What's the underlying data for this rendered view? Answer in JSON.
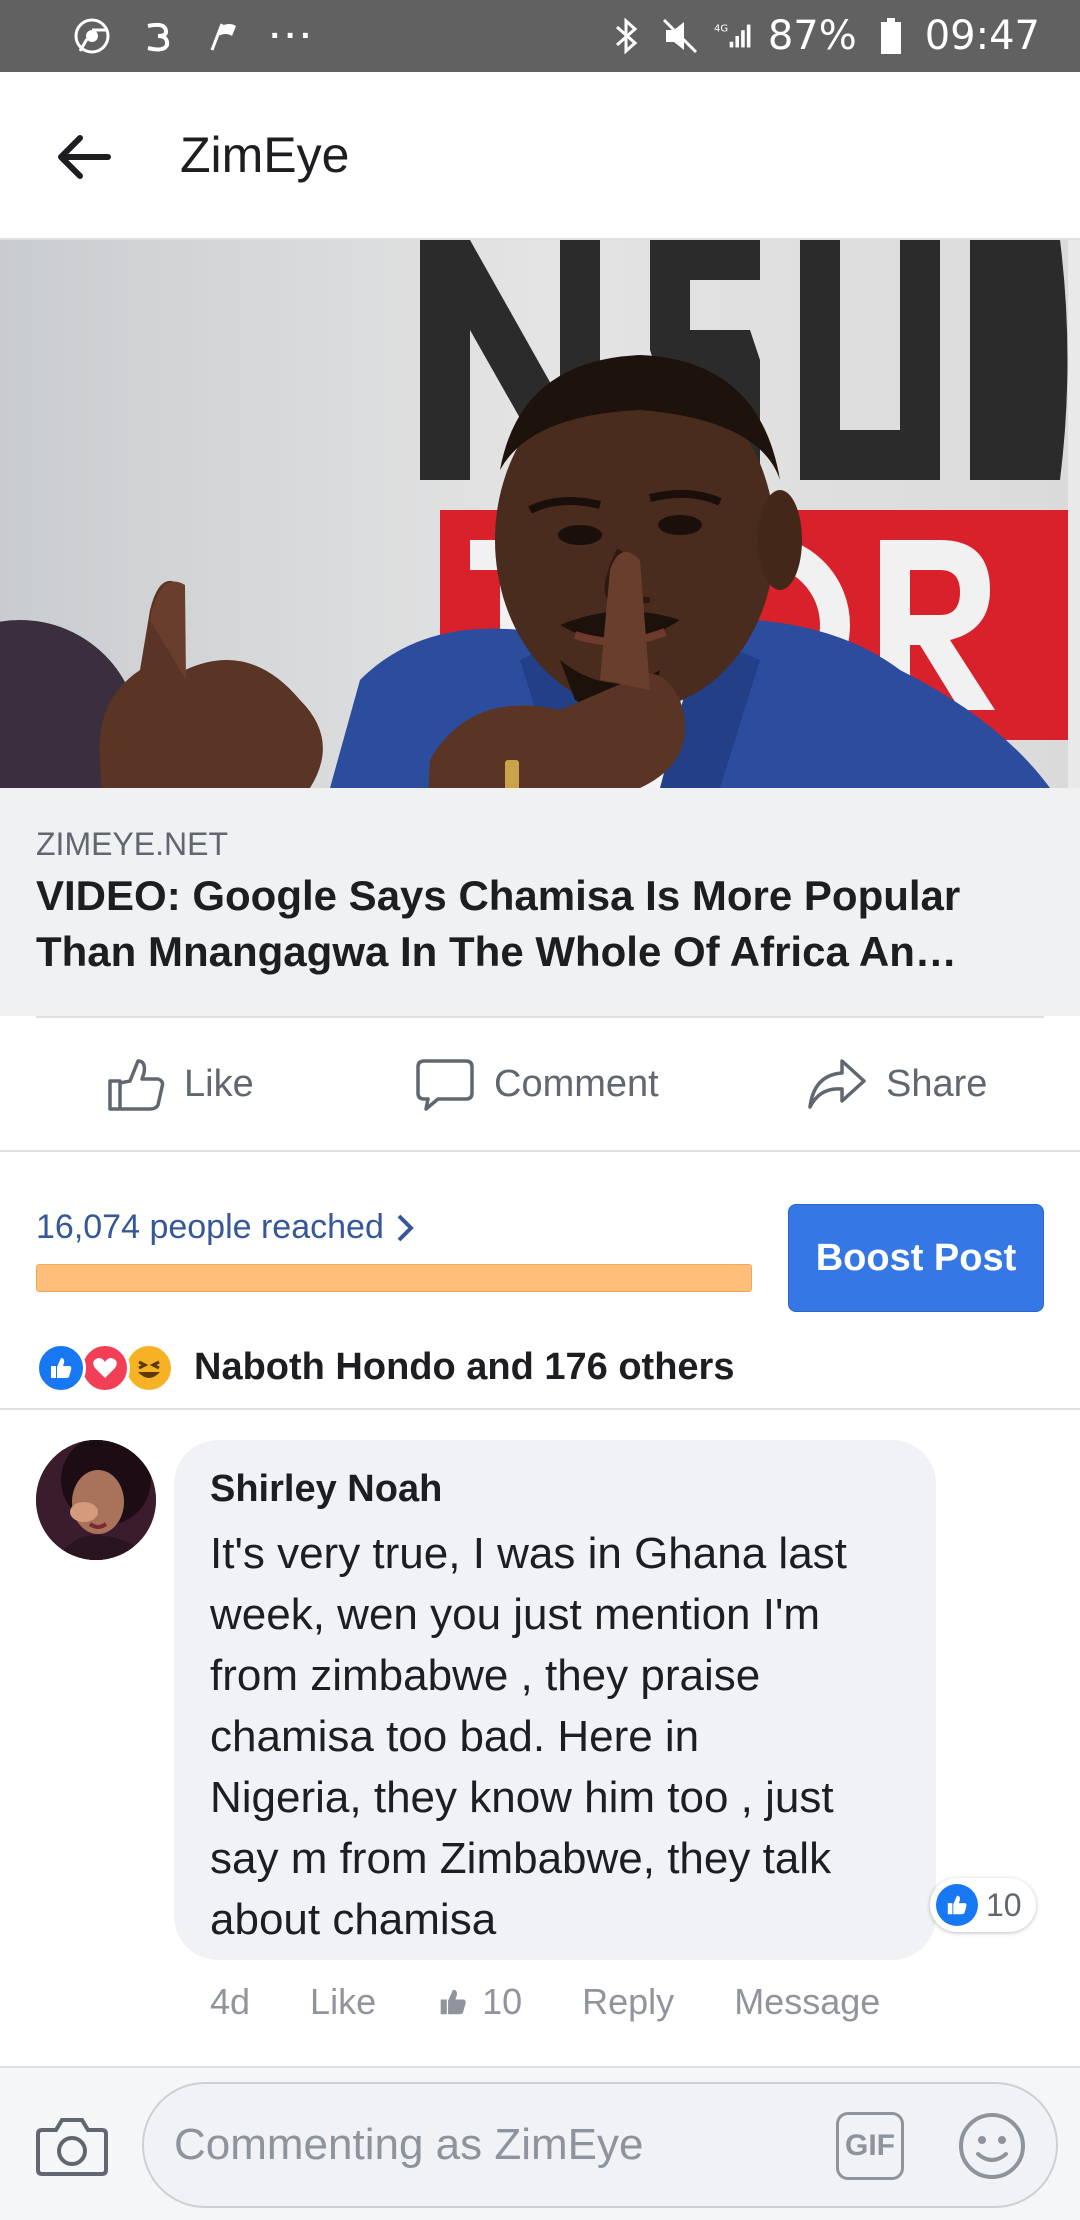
{
  "status_bar": {
    "battery": "87%",
    "time": "09:47",
    "network": "4G",
    "dots": "···"
  },
  "header": {
    "title": "ZimEye",
    "back_icon": "arrow-left-icon"
  },
  "post": {
    "link_domain": "ZIMEYE.NET",
    "link_title_line1": "VIDEO: Google Says Chamisa Is More Popular",
    "link_title_line2": "Than Mnangagwa In The Whole Of Africa An…",
    "actions": {
      "like": "Like",
      "comment": "Comment",
      "share": "Share"
    },
    "reach_text": "16,074 people reached",
    "reach_fill": 1.0,
    "boost_label": "Boost Post",
    "reactors_text": "Naboth Hondo and 176 others",
    "reaction_types": [
      "like",
      "love",
      "haha"
    ]
  },
  "comment": {
    "author": "Shirley Noah",
    "lines": [
      "It's very true, I was in Ghana last",
      "week, wen you just mention I'm",
      "from zimbabwe , they praise",
      "chamisa too bad. Here in",
      "Nigeria, they know him too , just",
      "say m from Zimbabwe, they talk",
      "about chamisa"
    ],
    "reaction_count": "10",
    "meta": {
      "age": "4d",
      "like": "Like",
      "likes_count": "10",
      "reply": "Reply",
      "message": "Message"
    }
  },
  "composer": {
    "placeholder": "Commenting as ZimEye",
    "gif_label": "GIF"
  },
  "colors": {
    "accent": "#3578e5",
    "link": "#365899",
    "reach_bar": "#ffbe7a",
    "status_bar": "#616161"
  }
}
